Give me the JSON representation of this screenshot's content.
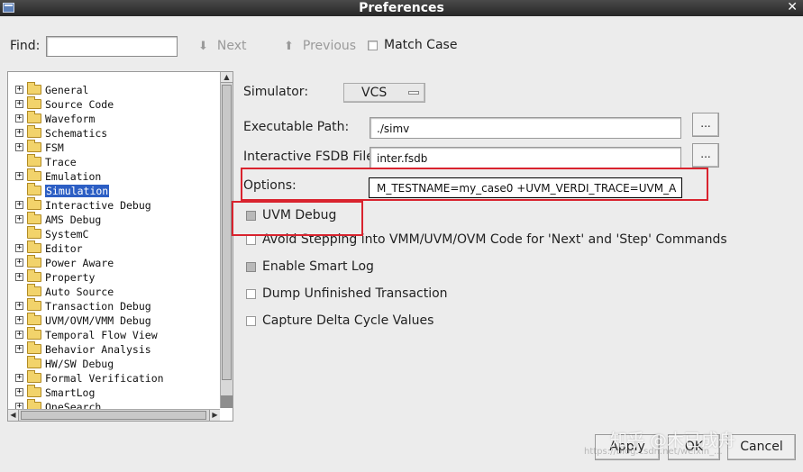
{
  "window": {
    "title": "Preferences"
  },
  "find": {
    "label": "Find:",
    "value": "",
    "next_label": "Next",
    "previous_label": "Previous",
    "match_case_label": "Match Case"
  },
  "tree": {
    "items": [
      {
        "label": "General",
        "expandable": true
      },
      {
        "label": "Source Code",
        "expandable": true
      },
      {
        "label": "Waveform",
        "expandable": true
      },
      {
        "label": "Schematics",
        "expandable": true
      },
      {
        "label": "FSM",
        "expandable": true
      },
      {
        "label": "Trace",
        "expandable": false
      },
      {
        "label": "Emulation",
        "expandable": true
      },
      {
        "label": "Simulation",
        "expandable": false,
        "selected": true
      },
      {
        "label": "Interactive Debug",
        "expandable": true
      },
      {
        "label": "AMS Debug",
        "expandable": true
      },
      {
        "label": "SystemC",
        "expandable": false
      },
      {
        "label": "Editor",
        "expandable": true
      },
      {
        "label": "Power Aware",
        "expandable": true
      },
      {
        "label": "Property",
        "expandable": true
      },
      {
        "label": "Auto Source",
        "expandable": false
      },
      {
        "label": "Transaction Debug",
        "expandable": true
      },
      {
        "label": "UVM/OVM/VMM Debug",
        "expandable": true
      },
      {
        "label": "Temporal Flow View",
        "expandable": true
      },
      {
        "label": "Behavior Analysis",
        "expandable": true
      },
      {
        "label": "HW/SW Debug",
        "expandable": false
      },
      {
        "label": "Formal Verification",
        "expandable": true
      },
      {
        "label": "SmartLog",
        "expandable": true
      },
      {
        "label": "OneSearch",
        "expandable": true
      }
    ]
  },
  "simulation": {
    "simulator_label": "Simulator:",
    "simulator_value": "VCS",
    "exec_label": "Executable Path:",
    "exec_value": "./simv",
    "fsdb_label": "Interactive FSDB File:",
    "fsdb_value": "inter.fsdb",
    "options_label": "Options:",
    "options_value": "M_TESTNAME=my_case0 +UVM_VERDI_TRACE=UVM_A",
    "browse_label": "...",
    "checkboxes": [
      {
        "label": "UVM Debug",
        "checked": true
      },
      {
        "label": "Avoid Stepping into VMM/UVM/OVM Code for 'Next' and 'Step' Commands",
        "checked": false
      },
      {
        "label": "Enable Smart Log",
        "checked": true
      },
      {
        "label": "Dump Unfinished Transaction",
        "checked": false
      },
      {
        "label": "Capture Delta Cycle Values",
        "checked": false
      }
    ]
  },
  "buttons": {
    "apply": "Apply",
    "ok": "OK",
    "cancel": "Cancel"
  },
  "watermark": {
    "text": "知乎 @木已成舟",
    "url_text": "https://blog.csdn.net/weixin_..."
  },
  "colors": {
    "selection": "#2c5ec4",
    "highlight_box": "#d9232e"
  }
}
